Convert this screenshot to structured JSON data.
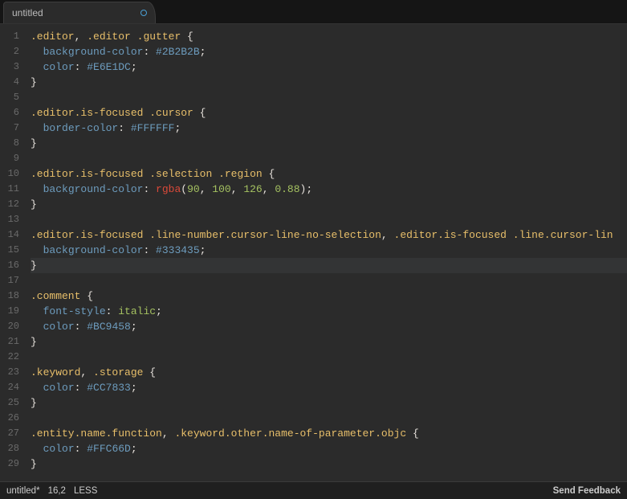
{
  "tab": {
    "title": "untitled",
    "modified": true
  },
  "cursor": {
    "row": 16,
    "col": 2
  },
  "status": {
    "filename": "untitled*",
    "position": "16,2",
    "grammar": "LESS",
    "feedback": "Send Feedback"
  },
  "code": {
    "lines": [
      [
        {
          "t": ".editor",
          "c": "sel"
        },
        {
          "t": ", ",
          "c": "punc"
        },
        {
          "t": ".editor",
          "c": "sel"
        },
        {
          "t": " ",
          "c": "punc"
        },
        {
          "t": ".gutter",
          "c": "sel"
        },
        {
          "t": " {",
          "c": "punc"
        }
      ],
      [
        {
          "t": "  ",
          "c": "punc"
        },
        {
          "t": "background-color",
          "c": "prop"
        },
        {
          "t": ": ",
          "c": "punc"
        },
        {
          "t": "#2B2B2B",
          "c": "hex"
        },
        {
          "t": ";",
          "c": "punc"
        }
      ],
      [
        {
          "t": "  ",
          "c": "punc"
        },
        {
          "t": "color",
          "c": "prop"
        },
        {
          "t": ": ",
          "c": "punc"
        },
        {
          "t": "#E6E1DC",
          "c": "hex"
        },
        {
          "t": ";",
          "c": "punc"
        }
      ],
      [
        {
          "t": "}",
          "c": "punc"
        }
      ],
      [],
      [
        {
          "t": ".editor",
          "c": "sel"
        },
        {
          "t": ".is-focused",
          "c": "pcls"
        },
        {
          "t": " ",
          "c": "punc"
        },
        {
          "t": ".cursor",
          "c": "sel"
        },
        {
          "t": " {",
          "c": "punc"
        }
      ],
      [
        {
          "t": "  ",
          "c": "punc"
        },
        {
          "t": "border-color",
          "c": "prop"
        },
        {
          "t": ": ",
          "c": "punc"
        },
        {
          "t": "#FFFFFF",
          "c": "hex"
        },
        {
          "t": ";",
          "c": "punc"
        }
      ],
      [
        {
          "t": "}",
          "c": "punc"
        }
      ],
      [],
      [
        {
          "t": ".editor",
          "c": "sel"
        },
        {
          "t": ".is-focused",
          "c": "pcls"
        },
        {
          "t": " ",
          "c": "punc"
        },
        {
          "t": ".selection",
          "c": "sel"
        },
        {
          "t": " ",
          "c": "punc"
        },
        {
          "t": ".region",
          "c": "sel"
        },
        {
          "t": " {",
          "c": "punc"
        }
      ],
      [
        {
          "t": "  ",
          "c": "punc"
        },
        {
          "t": "background-color",
          "c": "prop"
        },
        {
          "t": ": ",
          "c": "punc"
        },
        {
          "t": "rgba",
          "c": "func"
        },
        {
          "t": "(",
          "c": "punc"
        },
        {
          "t": "90",
          "c": "num"
        },
        {
          "t": ", ",
          "c": "punc"
        },
        {
          "t": "100",
          "c": "num"
        },
        {
          "t": ", ",
          "c": "punc"
        },
        {
          "t": "126",
          "c": "num"
        },
        {
          "t": ", ",
          "c": "punc"
        },
        {
          "t": "0.88",
          "c": "num"
        },
        {
          "t": ");",
          "c": "punc"
        }
      ],
      [
        {
          "t": "}",
          "c": "punc"
        }
      ],
      [],
      [
        {
          "t": ".editor",
          "c": "sel"
        },
        {
          "t": ".is-focused",
          "c": "pcls"
        },
        {
          "t": " ",
          "c": "punc"
        },
        {
          "t": ".line-number",
          "c": "sel"
        },
        {
          "t": ".cursor-line-no-selection",
          "c": "pcls"
        },
        {
          "t": ", ",
          "c": "punc"
        },
        {
          "t": ".editor",
          "c": "sel"
        },
        {
          "t": ".is-focused",
          "c": "pcls"
        },
        {
          "t": " ",
          "c": "punc"
        },
        {
          "t": ".line",
          "c": "sel"
        },
        {
          "t": ".cursor-lin",
          "c": "pcls"
        }
      ],
      [
        {
          "t": "  ",
          "c": "punc"
        },
        {
          "t": "background-color",
          "c": "prop"
        },
        {
          "t": ": ",
          "c": "punc"
        },
        {
          "t": "#333435",
          "c": "hex"
        },
        {
          "t": ";",
          "c": "punc"
        }
      ],
      [
        {
          "t": "}",
          "c": "punc"
        }
      ],
      [],
      [
        {
          "t": ".comment",
          "c": "sel"
        },
        {
          "t": " {",
          "c": "punc"
        }
      ],
      [
        {
          "t": "  ",
          "c": "punc"
        },
        {
          "t": "font-style",
          "c": "prop"
        },
        {
          "t": ": ",
          "c": "punc"
        },
        {
          "t": "italic",
          "c": "ital"
        },
        {
          "t": ";",
          "c": "punc"
        }
      ],
      [
        {
          "t": "  ",
          "c": "punc"
        },
        {
          "t": "color",
          "c": "prop"
        },
        {
          "t": ": ",
          "c": "punc"
        },
        {
          "t": "#BC9458",
          "c": "hex"
        },
        {
          "t": ";",
          "c": "punc"
        }
      ],
      [
        {
          "t": "}",
          "c": "punc"
        }
      ],
      [],
      [
        {
          "t": ".keyword",
          "c": "sel"
        },
        {
          "t": ", ",
          "c": "punc"
        },
        {
          "t": ".storage",
          "c": "sel"
        },
        {
          "t": " {",
          "c": "punc"
        }
      ],
      [
        {
          "t": "  ",
          "c": "punc"
        },
        {
          "t": "color",
          "c": "prop"
        },
        {
          "t": ": ",
          "c": "punc"
        },
        {
          "t": "#CC7833",
          "c": "hex"
        },
        {
          "t": ";",
          "c": "punc"
        }
      ],
      [
        {
          "t": "}",
          "c": "punc"
        }
      ],
      [],
      [
        {
          "t": ".entity",
          "c": "sel"
        },
        {
          "t": ".name",
          "c": "pcls"
        },
        {
          "t": ".function",
          "c": "pcls"
        },
        {
          "t": ", ",
          "c": "punc"
        },
        {
          "t": ".keyword",
          "c": "sel"
        },
        {
          "t": ".other",
          "c": "pcls"
        },
        {
          "t": ".name-of-parameter",
          "c": "pcls"
        },
        {
          "t": ".objc",
          "c": "pcls"
        },
        {
          "t": " {",
          "c": "punc"
        }
      ],
      [
        {
          "t": "  ",
          "c": "punc"
        },
        {
          "t": "color",
          "c": "prop"
        },
        {
          "t": ": ",
          "c": "punc"
        },
        {
          "t": "#FFC66D",
          "c": "hex"
        },
        {
          "t": ";",
          "c": "punc"
        }
      ],
      [
        {
          "t": "}",
          "c": "punc"
        }
      ]
    ]
  }
}
